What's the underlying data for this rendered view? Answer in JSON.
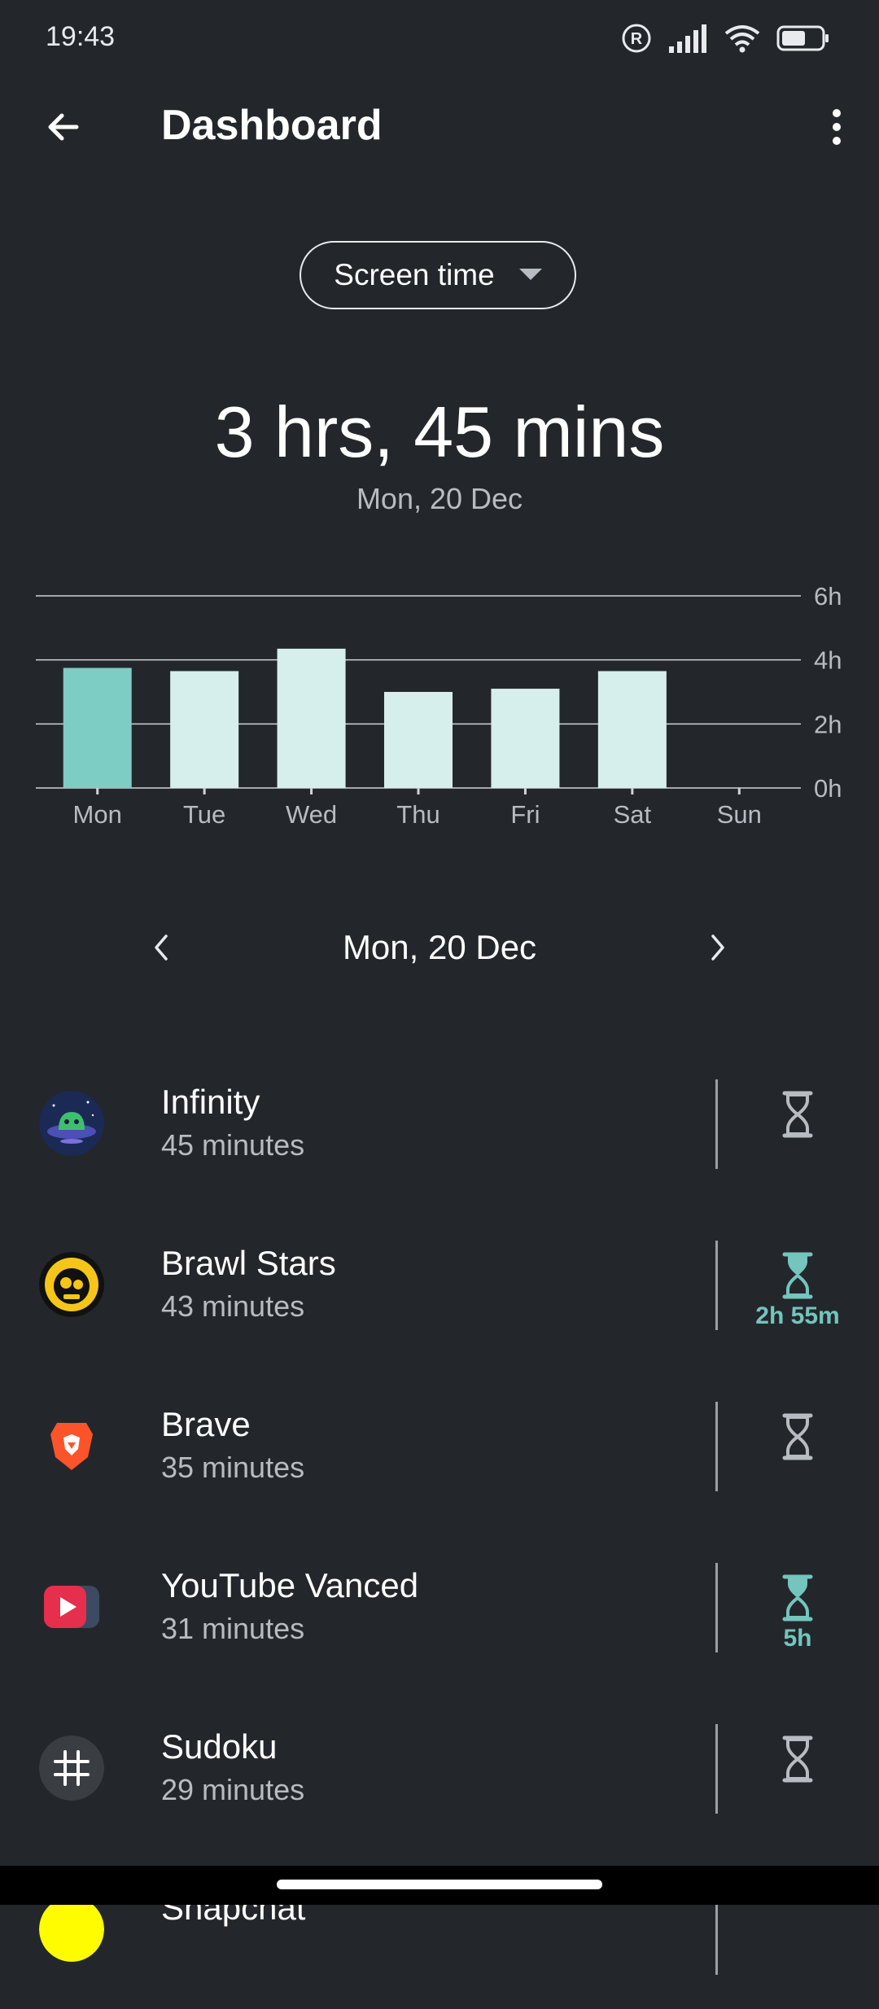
{
  "status_bar": {
    "time": "19:43"
  },
  "app_bar": {
    "title": "Dashboard",
    "icons": [
      "arrow-back-icon",
      "more-vert-icon"
    ]
  },
  "dropdown": {
    "selected": "Screen time"
  },
  "summary": {
    "total": "3 hrs, 45 mins",
    "date": "Mon, 20 Dec"
  },
  "colors": {
    "background": "#23272b",
    "bar_selected": "#7ecdc4",
    "bar_default": "#d7efec",
    "accent_teal": "#73c5bd",
    "gridline": "#d0d4d8"
  },
  "chart_data": {
    "type": "bar",
    "categories": [
      "Mon",
      "Tue",
      "Wed",
      "Thu",
      "Fri",
      "Sat",
      "Sun"
    ],
    "values": [
      3.75,
      3.65,
      4.35,
      3.0,
      3.1,
      3.65,
      0
    ],
    "selected_index": 0,
    "y_ticks": [
      {
        "value": 6,
        "label": "6h"
      },
      {
        "value": 4,
        "label": "4h"
      },
      {
        "value": 2,
        "label": "2h"
      },
      {
        "value": 0,
        "label": "0h"
      }
    ],
    "ylim": [
      0,
      6
    ],
    "grid": true
  },
  "date_nav": {
    "label": "Mon, 20 Dec"
  },
  "apps": [
    {
      "name": "Infinity",
      "usage": "45 minutes",
      "icon": "infinity-app-icon",
      "timer": "",
      "timer_active": false
    },
    {
      "name": "Brawl Stars",
      "usage": "43 minutes",
      "icon": "brawl-stars-app-icon",
      "timer": "2h 55m",
      "timer_active": true
    },
    {
      "name": "Brave",
      "usage": "35 minutes",
      "icon": "brave-app-icon",
      "timer": "",
      "timer_active": false
    },
    {
      "name": "YouTube Vanced",
      "usage": "31 minutes",
      "icon": "youtube-vanced-app-icon",
      "timer": "5h",
      "timer_active": true
    },
    {
      "name": "Sudoku",
      "usage": "29 minutes",
      "icon": "sudoku-app-icon",
      "timer": "",
      "timer_active": false
    },
    {
      "name": "Snapchat",
      "usage": "",
      "icon": "snapchat-app-icon",
      "timer": "",
      "timer_active": false
    }
  ]
}
